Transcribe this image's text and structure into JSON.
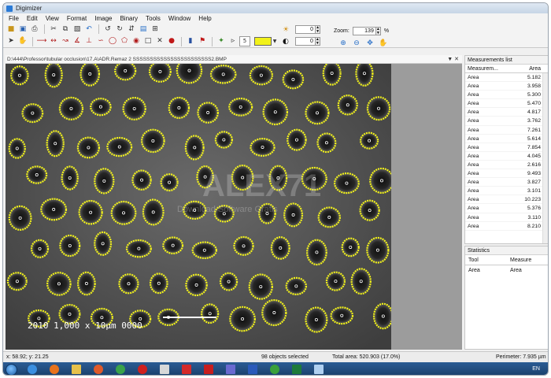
{
  "window": {
    "title": "Digimizer"
  },
  "menu": [
    "File",
    "Edit",
    "View",
    "Format",
    "Image",
    "Binary",
    "Tools",
    "Window",
    "Help"
  ],
  "toolbar": {
    "brightness_value": "0",
    "contrast_value": "0",
    "zoom_label": "Zoom:",
    "zoom_value": "139",
    "zoom_unit": "%",
    "stepper_value": "5",
    "marker_color": "#f2f21a"
  },
  "image_panel": {
    "path": "D:\\444\\Professor\\tubular occlusion\\17.A\\ADR.Remaz 2 SSSSSSSSSSSSSSSSSSSSSSS2.BMP",
    "watermark": "ALEX71",
    "watermark_sub": "Download Software Gratis",
    "scale_text": "2010   1,000 x   10µm  0000"
  },
  "measurements": {
    "title": "Measurements list",
    "col_name": "Measurem...",
    "col_value": "Area",
    "rows": [
      {
        "name": "Area",
        "value": "5.182"
      },
      {
        "name": "Area",
        "value": "3.958"
      },
      {
        "name": "Area",
        "value": "5.300"
      },
      {
        "name": "Area",
        "value": "5.470"
      },
      {
        "name": "Area",
        "value": "4.817"
      },
      {
        "name": "Area",
        "value": "3.762"
      },
      {
        "name": "Area",
        "value": "7.261"
      },
      {
        "name": "Area",
        "value": "5.614"
      },
      {
        "name": "Area",
        "value": "7.854"
      },
      {
        "name": "Area",
        "value": "4.045"
      },
      {
        "name": "Area",
        "value": "2.616"
      },
      {
        "name": "Area",
        "value": "9.493"
      },
      {
        "name": "Area",
        "value": "3.827"
      },
      {
        "name": "Area",
        "value": "3.101"
      },
      {
        "name": "Area",
        "value": "10.223"
      },
      {
        "name": "Area",
        "value": "5.376"
      },
      {
        "name": "Area",
        "value": "3.110"
      },
      {
        "name": "Area",
        "value": "8.210"
      }
    ]
  },
  "statistics": {
    "title": "Statistics",
    "col_tool": "Tool",
    "col_measure": "Measure",
    "rows": [
      {
        "tool": "Area",
        "measure": "Area"
      }
    ]
  },
  "status": {
    "coords": "x: 58.92; y: 21.25",
    "selected": "98 objects selected",
    "total_area": "Total area: 520.903 (17.0%)",
    "perimeter": "Perimeter: 7.935 µm"
  },
  "taskbar": {
    "lang": "EN"
  }
}
